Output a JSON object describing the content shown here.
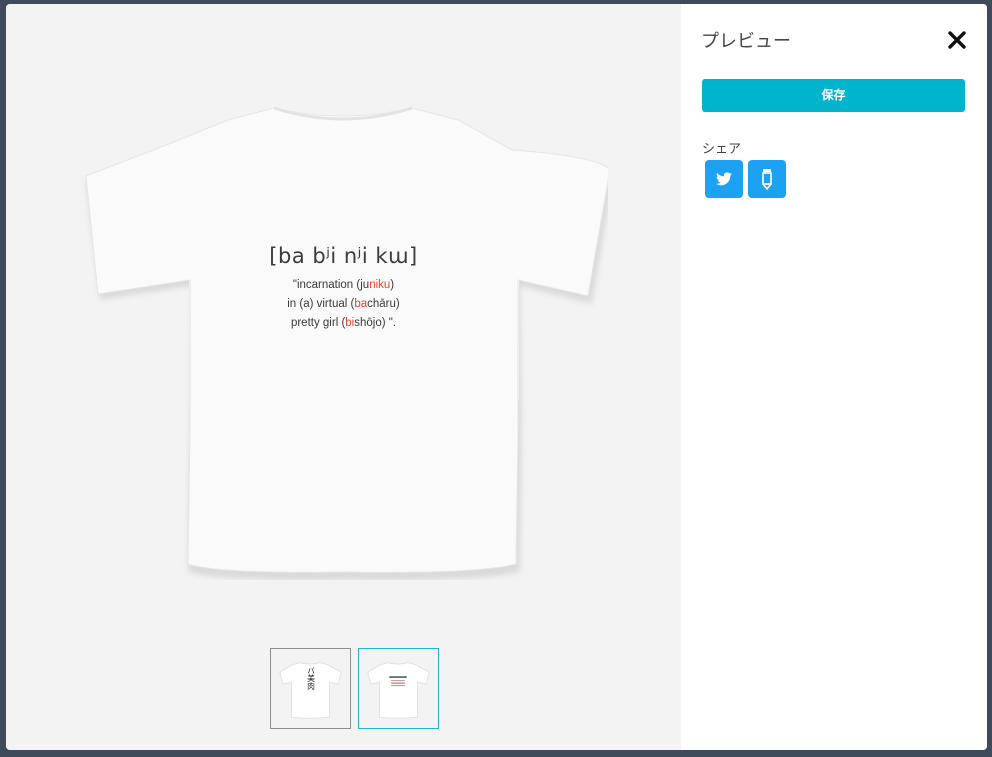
{
  "preview": {
    "print": {
      "phonetic": "[ba bʲi nʲi kɯ]",
      "line1": {
        "pre": "\"incarnation (ju",
        "hl": "niku",
        "post": ")"
      },
      "line2": {
        "pre": "in (a) virtual (",
        "hl": "ba",
        "post": "chāru)"
      },
      "line3": {
        "pre": "pretty girl (",
        "hl": "bi",
        "post": "shōjo) \"."
      }
    },
    "thumbnails": [
      {
        "name": "front",
        "text": "バ美肉",
        "selected": false
      },
      {
        "name": "back",
        "selected": true
      }
    ]
  },
  "panel": {
    "title": "プレビュー",
    "save_label": "保存",
    "share_label": "シェア",
    "share_buttons": [
      {
        "icon": "twitter-icon"
      },
      {
        "icon": "pencil-icon"
      }
    ]
  },
  "colors": {
    "accent": "#00b4cc",
    "share": "#1da1f2",
    "highlight": "#e6452e",
    "backdrop": "#3f4a5a"
  }
}
